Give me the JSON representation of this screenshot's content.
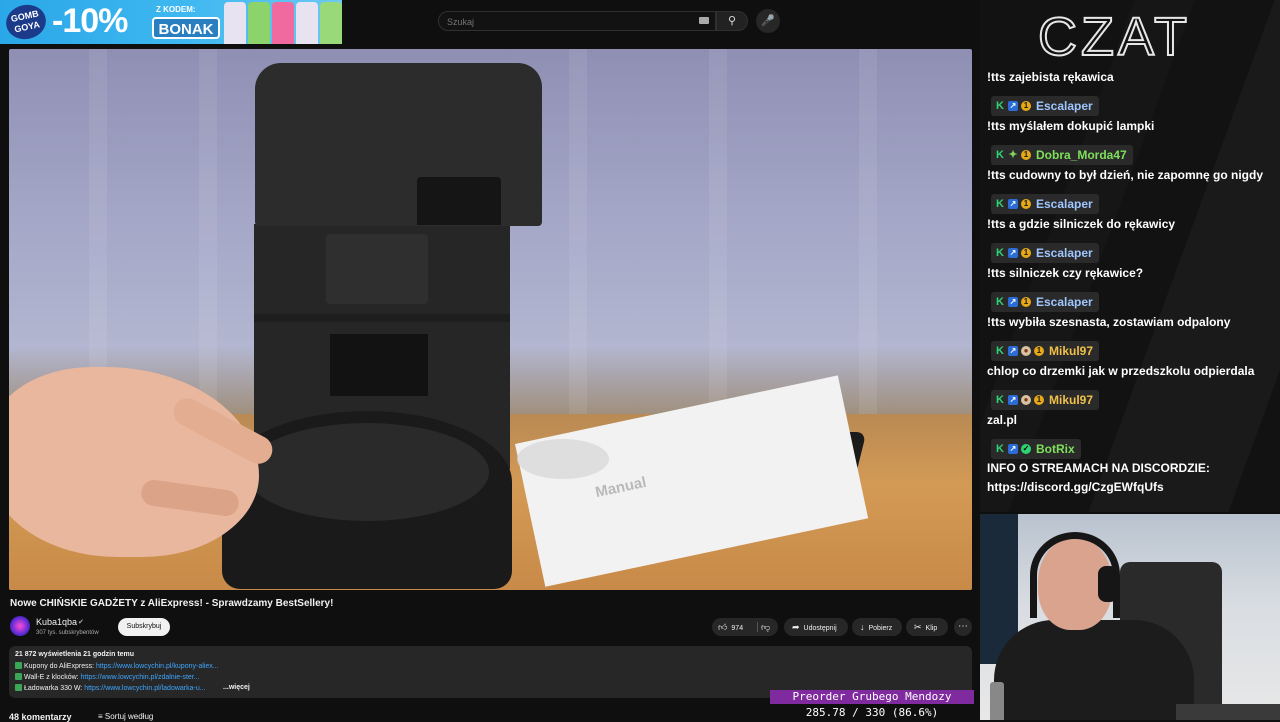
{
  "promo": {
    "brand": "GOMB GOYA",
    "discount": "-10%",
    "code_label": "Z KODEM:",
    "code": "BONAK",
    "can_colors": [
      "#e8e3f0",
      "#8bd36a",
      "#f06aa0",
      "#e8e3f0",
      "#9ad97a"
    ]
  },
  "search": {
    "placeholder": "Szukaj"
  },
  "video": {
    "title": "Nowe CHIŃSKIE GADŻETY z AliExpress! - Sprawdzamy BestSellery!",
    "scene_text": "Manual"
  },
  "channel": {
    "name": "Kuba1qba",
    "subscribers": "307 tys. subskrybentów",
    "subscribe_label": "Subskrybuj"
  },
  "actions": {
    "likes": "974",
    "share_label": "Udostępnij",
    "download_label": "Pobierz",
    "clip_label": "Klip",
    "more_label": "⋯"
  },
  "description": {
    "stats": "21 872 wyświetlenia  21 godzin temu",
    "lines": [
      {
        "label": "Kupony do AliExpress: ",
        "link": "https://www.lowcychin.pl/kupony-aliex..."
      },
      {
        "label": "Wall-E z klocków: ",
        "link": "https://www.lowcychin.pl/zdalnie-ster..."
      },
      {
        "label": "Ładowarka 330 W: ",
        "link": "https://www.lowcychin.pl/ladowarka-u..."
      }
    ],
    "more_label": "...więcej"
  },
  "comments": {
    "count_label": "48 komentarzy",
    "sort_label": "Sortuj według"
  },
  "chat": {
    "title": "CZAT",
    "messages": [
      {
        "user": "",
        "text": "!tts zajebista rękawica"
      },
      {
        "user": "Escalaper",
        "user_color": "#9ec6ff",
        "badges": [
          "k",
          "arrow",
          "coin"
        ],
        "text": "!tts myślałem dokupić lampki"
      },
      {
        "user": "Dobra_Morda47",
        "user_color": "#7ee05a",
        "badges": [
          "k",
          "star",
          "coin"
        ],
        "text": "!tts cudowny to był dzień, nie zapomnę go nigdy"
      },
      {
        "user": "Escalaper",
        "user_color": "#9ec6ff",
        "badges": [
          "k",
          "arrow",
          "coin"
        ],
        "text": "!tts a gdzie silniczek do rękawicy"
      },
      {
        "user": "Escalaper",
        "user_color": "#9ec6ff",
        "badges": [
          "k",
          "arrow",
          "coin"
        ],
        "text": "!tts silniczek czy rękawice?"
      },
      {
        "user": "Escalaper",
        "user_color": "#9ec6ff",
        "badges": [
          "k",
          "arrow",
          "coin"
        ],
        "text": "!tts wybiła szesnasta, zostawiam odpalony"
      },
      {
        "user": "Mikul97",
        "user_color": "#f0c04a",
        "badges": [
          "k",
          "arrow",
          "skull",
          "coin"
        ],
        "text": "chlop co drzemki jak w przedszkolu odpierdala"
      },
      {
        "user": "Mikul97",
        "user_color": "#f0c04a",
        "badges": [
          "k",
          "arrow",
          "skull",
          "coin"
        ],
        "text": "zal.pl"
      },
      {
        "user": "BotRix",
        "user_color": "#7ee05a",
        "badges": [
          "k",
          "arrow",
          "check"
        ],
        "text": "INFO O STREAMACH NA DISCORDZIE:",
        "text2": "https://discord.gg/CzgEWfqUfs"
      }
    ]
  },
  "overlay": {
    "goal_label": "Preorder Grubego Mendozy",
    "goal_progress": "285.78 / 330 (86.6%)",
    "goal_current": 285.78,
    "goal_target": 330
  }
}
